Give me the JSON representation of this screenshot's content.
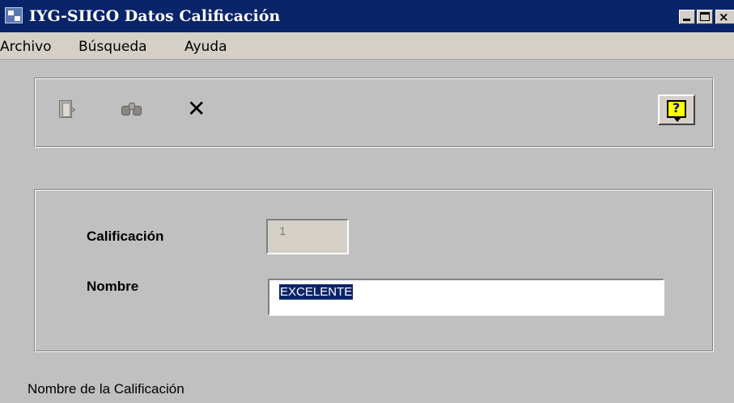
{
  "window": {
    "title": "IYG-SIIGO  Datos Calificación",
    "controls": {
      "minimize_icon": "minimize-icon",
      "maximize_icon": "maximize-icon",
      "close_icon": "close-icon"
    }
  },
  "menu": {
    "items": [
      {
        "label": "Archivo"
      },
      {
        "label": "Búsqueda"
      },
      {
        "label": "Ayuda"
      }
    ]
  },
  "toolbar": {
    "buttons": [
      {
        "icon": "exit-door-icon"
      },
      {
        "icon": "binoculars-search-icon"
      },
      {
        "icon": "cancel-x-icon"
      },
      {
        "icon": "help-question-icon",
        "glyph": "?"
      }
    ],
    "cancel_glyph": "✕"
  },
  "form": {
    "calificacion": {
      "label": "Calificación",
      "value": "1",
      "enabled": false
    },
    "nombre": {
      "label": "Nombre",
      "value": "EXCELENTE",
      "selected": true
    }
  },
  "status": {
    "text": "Nombre de la Calificación"
  },
  "colors": {
    "titlebar": "#0a246a",
    "window_background": "#c0c0c0",
    "selection": "#0a246a",
    "help_icon": "#ffff00"
  }
}
